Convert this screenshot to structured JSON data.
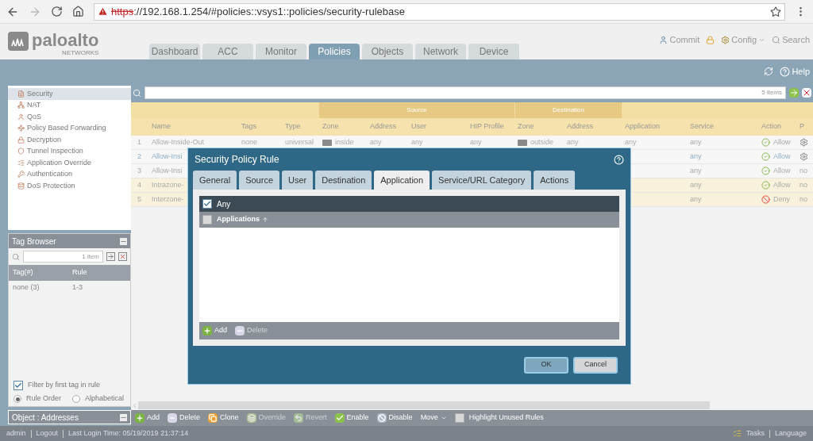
{
  "browser": {
    "url_scheme": "https",
    "url_rest": "://192.168.1.254/#policies::vsys1::policies/security-rulebase"
  },
  "logo": {
    "name": "paloalto",
    "tagline": "NETWORKS"
  },
  "nav_tabs": [
    {
      "label": "Dashboard",
      "selected": false
    },
    {
      "label": "ACC",
      "selected": false
    },
    {
      "label": "Monitor",
      "selected": false
    },
    {
      "label": "Policies",
      "selected": true
    },
    {
      "label": "Objects",
      "selected": false
    },
    {
      "label": "Network",
      "selected": false
    },
    {
      "label": "Device",
      "selected": false
    }
  ],
  "header_actions": {
    "commit": "Commit",
    "config": "Config",
    "search": "Search"
  },
  "help": "Help",
  "sidebar": {
    "items": [
      {
        "label": "Security",
        "selected": true
      },
      {
        "label": "NAT",
        "selected": false
      },
      {
        "label": "QoS",
        "selected": false
      },
      {
        "label": "Policy Based Forwarding",
        "selected": false
      },
      {
        "label": "Decryption",
        "selected": false
      },
      {
        "label": "Tunnel Inspection",
        "selected": false
      },
      {
        "label": "Application Override",
        "selected": false
      },
      {
        "label": "Authentication",
        "selected": false
      },
      {
        "label": "DoS Protection",
        "selected": false
      }
    ]
  },
  "tag_browser": {
    "title": "Tag Browser",
    "count": "1 item",
    "columns": [
      "Tag(#)",
      "Rule"
    ],
    "rows": [
      [
        "none (3)",
        "1-3"
      ]
    ],
    "filter": {
      "label": "Filter by first tag in rule",
      "checked": true
    },
    "sort": [
      {
        "label": "Rule Order",
        "selected": true
      },
      {
        "label": "Alphabetical",
        "selected": false
      }
    ]
  },
  "object_panel": {
    "title": "Object : Addresses"
  },
  "filter_bar": {
    "count": "5 items"
  },
  "table": {
    "groups": [
      "Source",
      "Destination"
    ],
    "columns": [
      "Name",
      "Tags",
      "Type",
      "Zone",
      "Address",
      "User",
      "HIP Profile",
      "Zone",
      "Address",
      "Application",
      "Service",
      "Action",
      "P"
    ],
    "rows": [
      {
        "number": "1",
        "selected": false,
        "kind": "rule",
        "cells": {
          "name": {
            "kind": "text",
            "text": "Allow-Inside-Out"
          },
          "tags": {
            "kind": "text",
            "text": "none"
          },
          "type": {
            "kind": "text",
            "text": "universal"
          },
          "source_zone": {
            "kind": "zone",
            "text": "inside"
          },
          "source_address": {
            "kind": "text",
            "text": "any"
          },
          "user": {
            "kind": "text",
            "text": "any"
          },
          "hip_profile": {
            "kind": "text",
            "text": "any"
          },
          "destination_zone": {
            "kind": "zone",
            "text": "outside"
          },
          "destination_address": {
            "kind": "text",
            "text": "any"
          },
          "application": {
            "kind": "text",
            "text": "any"
          },
          "service": {
            "kind": "text",
            "text": "any"
          },
          "action": {
            "kind": "allow",
            "text": "Allow"
          },
          "profile": {
            "kind": "icon"
          }
        }
      },
      {
        "number": "2",
        "selected": true,
        "kind": "rule",
        "cells": {
          "name": {
            "kind": "text",
            "text": "Allow-Insi"
          },
          "service": {
            "kind": "text",
            "text": "any"
          },
          "action": {
            "kind": "allow",
            "text": "Allow"
          },
          "profile": {
            "kind": "icon"
          }
        }
      },
      {
        "number": "3",
        "selected": false,
        "kind": "rule",
        "cells": {
          "name": {
            "kind": "text",
            "text": "Allow-Insi"
          },
          "service": {
            "kind": "text",
            "text": "any"
          },
          "action": {
            "kind": "allow",
            "text": "Allow"
          },
          "profile": {
            "kind": "text",
            "text": "no"
          }
        }
      },
      {
        "number": "4",
        "selected": false,
        "kind": "default",
        "cells": {
          "name": {
            "kind": "text",
            "text": "Intrazone-"
          },
          "service": {
            "kind": "text",
            "text": "any"
          },
          "action": {
            "kind": "allow",
            "text": "Allow"
          },
          "profile": {
            "kind": "text",
            "text": "no"
          }
        }
      },
      {
        "number": "5",
        "selected": false,
        "kind": "default",
        "cells": {
          "name": {
            "kind": "text",
            "text": "Interzone-"
          },
          "service": {
            "kind": "text",
            "text": "any"
          },
          "action": {
            "kind": "deny",
            "text": "Deny"
          },
          "profile": {
            "kind": "text",
            "text": "no"
          }
        }
      }
    ]
  },
  "modal": {
    "title": "Security Policy Rule",
    "tabs": [
      {
        "label": "General",
        "selected": false
      },
      {
        "label": "Source",
        "selected": false
      },
      {
        "label": "User",
        "selected": false
      },
      {
        "label": "Destination",
        "selected": false
      },
      {
        "label": "Application",
        "selected": true
      },
      {
        "label": "Service/URL Category",
        "selected": false
      },
      {
        "label": "Actions",
        "selected": false
      }
    ],
    "any": {
      "label": "Any",
      "checked": true
    },
    "list_header": "Applications",
    "select_all": {
      "checked": false
    },
    "list_actions": [
      {
        "label": "Add",
        "kind": "add",
        "disabled": false
      },
      {
        "label": "Delete",
        "kind": "delete",
        "disabled": true
      }
    ],
    "buttons": [
      {
        "label": "OK",
        "kind": "primary"
      },
      {
        "label": "Cancel",
        "kind": "secondary"
      }
    ]
  },
  "toolbar": {
    "actions": [
      {
        "label": "Add",
        "kind": "add",
        "disabled": false
      },
      {
        "label": "Delete",
        "kind": "delete",
        "disabled": false
      },
      {
        "label": "Clone",
        "kind": "clone",
        "disabled": false
      },
      {
        "label": "Override",
        "kind": "override",
        "disabled": true
      },
      {
        "label": "Revert",
        "kind": "revert",
        "disabled": true
      },
      {
        "label": "Enable",
        "kind": "enable",
        "disabled": false
      },
      {
        "label": "Disable",
        "kind": "disable",
        "disabled": false
      },
      {
        "label": "Move",
        "kind": "move",
        "disabled": false
      }
    ],
    "highlight": {
      "label": "Highlight Unused Rules",
      "checked": false
    }
  },
  "status_bar": {
    "user": "admin",
    "logout": "Logout",
    "last_login": "Last Login Time: 05/19/2019 21:37:14",
    "tasks": "Tasks",
    "language": "Language"
  }
}
